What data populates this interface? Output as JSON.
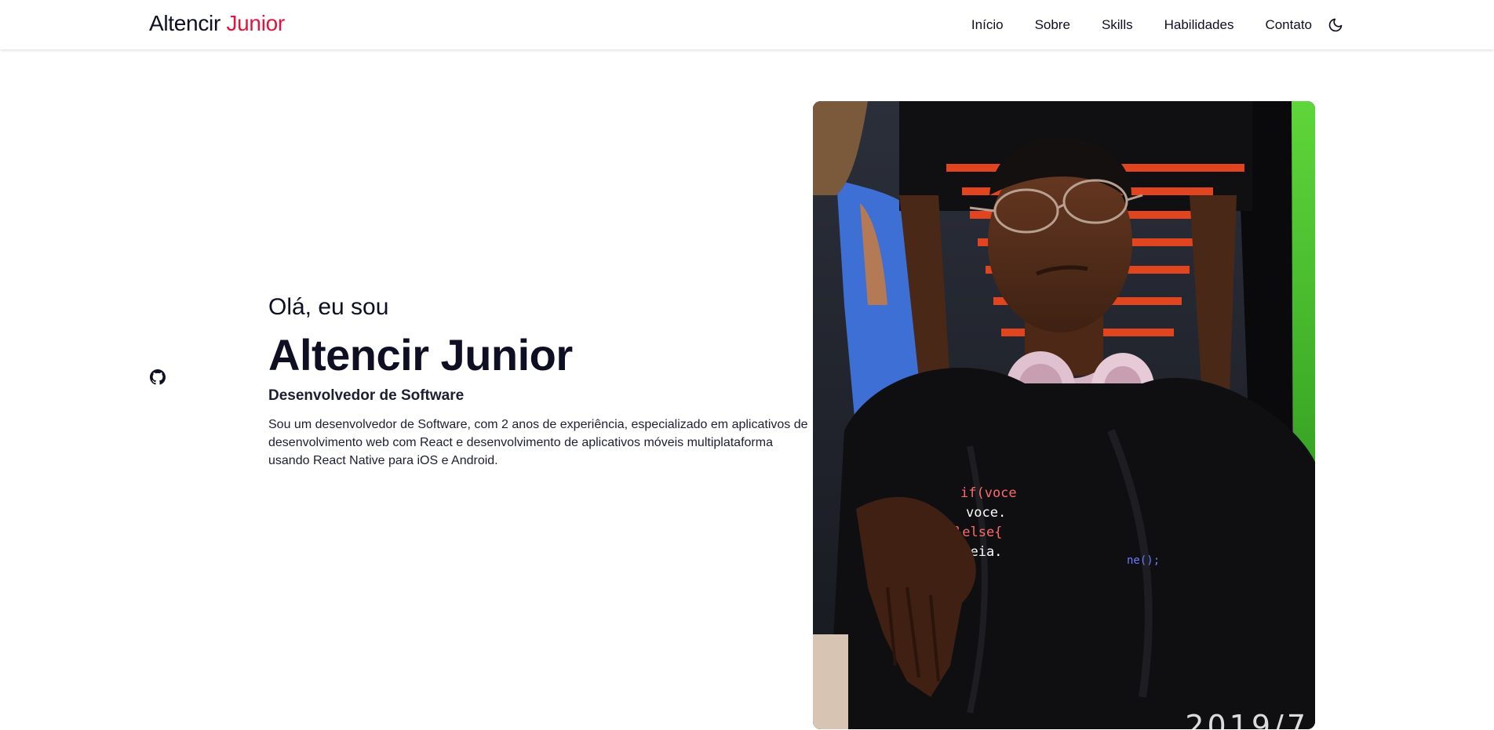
{
  "header": {
    "logo_first": "Altencir",
    "logo_accent": "Junior",
    "nav": [
      {
        "label": "Início"
      },
      {
        "label": "Sobre"
      },
      {
        "label": "Skills"
      },
      {
        "label": "Habilidades"
      },
      {
        "label": "Contato"
      }
    ],
    "theme_icon": "moon-icon"
  },
  "social": {
    "icon": "github-icon"
  },
  "hero": {
    "greeting": "Olá, eu sou",
    "name": "Altencir Junior",
    "role": "Desenvolvedor de Software",
    "description": "Sou um desenvolvedor de Software, com 2 anos de experiência, especializado em aplicativos de desenvolvimento web com React e desenvolvimento de aplicativos móveis multiplataforma usando React Native para iOS e Android."
  },
  "photo": {
    "stamp": "2019/7"
  },
  "colors": {
    "text": "#0e0f23",
    "accent": "#e2133d",
    "background": "#ffffff"
  }
}
